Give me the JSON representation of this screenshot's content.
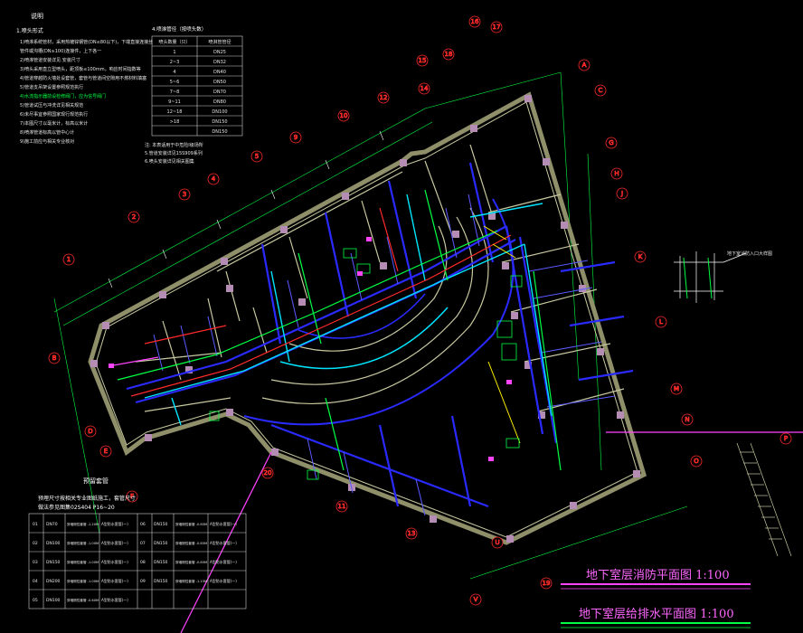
{
  "notes": {
    "heading": "说明",
    "section": "1.喷头形式",
    "lines": [
      "1)喷淋系统管材，采用热镀锌钢管(DN≤80以下)，下端直接连接丝",
      "   管件或沟槽(DN≥100)连接件，上下各一",
      "2)喷淋管道安装详见.安装尺寸",
      "3)喷头采用直立型喷头，距顶板≤100mm，响应时间指数等",
      "4)管道穿越防火墙处设套管，套管与管道间空隙用不燃材料填塞",
      "5)管道支吊架设置参照规范执行",
      "4)水流指示器前设检修阀门，应为信号阀门",
      "5)管道试压与冲洗详见相关规范",
      "6)未尽事宜参照国家现行规范执行",
      "7)本图尺寸以毫米计，标高以米计",
      "8)喷淋管道标高以管中心计",
      "9)施工前应与相关专业核对"
    ]
  },
  "pipe_table": {
    "title": "4.喷淋管径（按喷头数）",
    "headers": [
      "喷头数量（只）",
      "喷淋管管径"
    ],
    "rows": [
      [
        "1",
        "DN25"
      ],
      [
        "2~3",
        "DN32"
      ],
      [
        "4",
        "DN40"
      ],
      [
        "5~6",
        "DN50"
      ],
      [
        "7~8",
        "DN70"
      ],
      [
        "9~11",
        "DN80"
      ],
      [
        "12~18",
        "DN100"
      ],
      [
        ">18",
        "DN150"
      ],
      [
        "",
        "DN150"
      ]
    ],
    "footnotes": [
      "注: 本表适用于中危险Ⅰ级场所",
      "5.管道安装详见15S909系列",
      "6.喷头安装详见相关图集"
    ]
  },
  "sleeve": {
    "title": "预留套管",
    "sub1": "预埋尺寸按相关专业图纸施工，套管尺寸",
    "sub2": "做法参见图集02S404 P16~20",
    "rows": [
      [
        "01",
        "DN70",
        "穿墙刚性套管 -1.20M",
        "A型防水套管(一)",
        "06",
        "DN150",
        "穿墙刚性套管 -0.85M",
        "A型防水套管(一)"
      ],
      [
        "02",
        "DN100",
        "穿墙刚性套管 -1.00M",
        "A型防水套管(一)",
        "07",
        "DN150",
        "穿墙刚性套管 -0.85M",
        "A型防水套管(一)"
      ],
      [
        "03",
        "DN150",
        "穿墙刚性套管 -1.00M",
        "A型防水套管(一)",
        "08",
        "DN150",
        "穿墙刚性套管 -0.85M",
        "A型防水套管(一)"
      ],
      [
        "04",
        "DN200",
        "穿墙刚性套管 -1.00M",
        "A型防水套管(一)",
        "09",
        "DN150",
        "穿墙刚性套管 -1.15M",
        "A型防水套管(一)"
      ],
      [
        "05",
        "DN100",
        "穿墙刚性套管 -0.60M",
        "A型防水套管(一)",
        "",
        "",
        "",
        ""
      ]
    ]
  },
  "drawing_titles": {
    "fire": "地下室层消防平面图  1:100",
    "water": "地下室层给排水平面图 1:100"
  },
  "axis_labels": {
    "right": [
      "A",
      "C",
      "G",
      "H",
      "J",
      "K",
      "L",
      "M",
      "N",
      "O",
      "P"
    ],
    "left": [
      "1",
      "2",
      "3",
      "4",
      "B",
      "D",
      "E",
      "F"
    ],
    "top": [
      "16",
      "17",
      "18",
      "15",
      "14",
      "12",
      "10",
      "9",
      "8",
      "7",
      "6",
      "5"
    ],
    "bottom": [
      "U",
      "V",
      "W",
      "X",
      "Y",
      "Z",
      "11",
      "13",
      "19",
      "20"
    ]
  },
  "side_note": "地下室消防入口大样图",
  "colors": {
    "wall": "#8f8f6a",
    "sprinkler": "#2a2aff",
    "cyan": "#00e5ff",
    "green": "#00ff44",
    "red": "#ff2a2a",
    "magenta": "#ff44ff",
    "yellow": "#ffee00"
  }
}
